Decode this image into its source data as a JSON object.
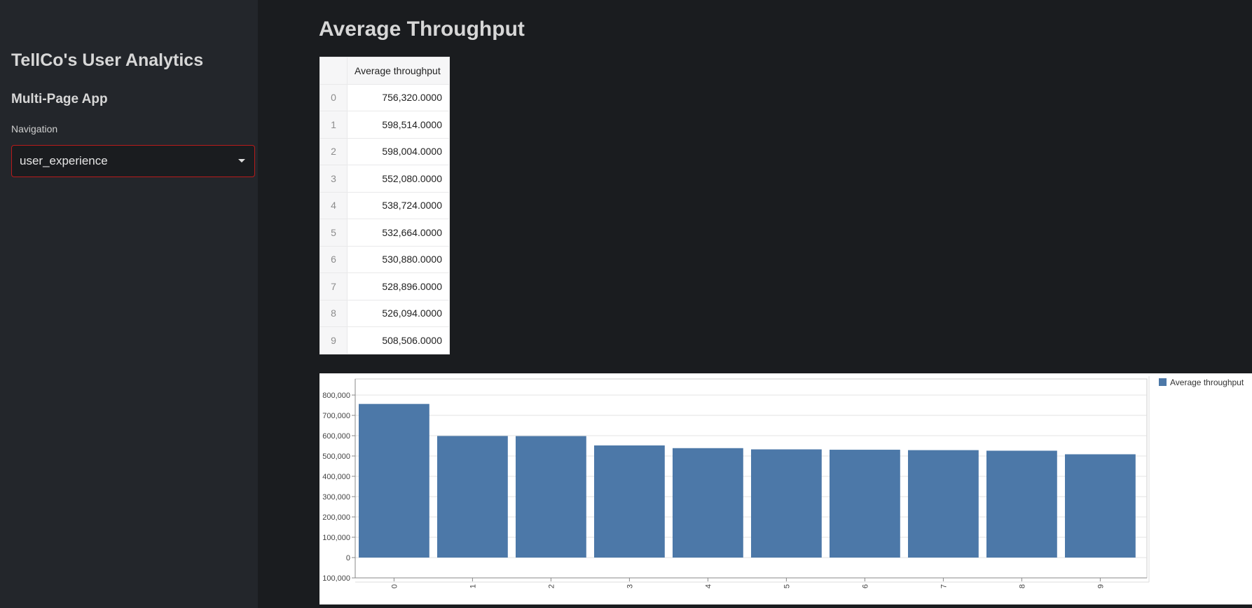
{
  "sidebar": {
    "app_title": "TellCo's User Analytics",
    "subtitle": "Multi-Page App",
    "nav_label": "Navigation",
    "selected_page": "user_experience"
  },
  "main": {
    "page_title": "Average Throughput",
    "table": {
      "columns": [
        "",
        "Average throughput"
      ],
      "rows": [
        {
          "index": "0",
          "value": "756,320.0000"
        },
        {
          "index": "1",
          "value": "598,514.0000"
        },
        {
          "index": "2",
          "value": "598,004.0000"
        },
        {
          "index": "3",
          "value": "552,080.0000"
        },
        {
          "index": "4",
          "value": "538,724.0000"
        },
        {
          "index": "5",
          "value": "532,664.0000"
        },
        {
          "index": "6",
          "value": "530,880.0000"
        },
        {
          "index": "7",
          "value": "528,896.0000"
        },
        {
          "index": "8",
          "value": "526,094.0000"
        },
        {
          "index": "9",
          "value": "508,506.0000"
        }
      ]
    }
  },
  "colors": {
    "accent": "#b81b1b",
    "bar": "#4c78a8"
  },
  "chart_data": {
    "type": "bar",
    "categories": [
      "0",
      "1",
      "2",
      "3",
      "4",
      "5",
      "6",
      "7",
      "8",
      "9"
    ],
    "series": [
      {
        "name": "Average throughput",
        "values": [
          756320,
          598514,
          598004,
          552080,
          538724,
          532664,
          530880,
          528896,
          526094,
          508506
        ]
      }
    ],
    "ylim": [
      -100000,
      800000
    ],
    "yticks": [
      -100000,
      0,
      100000,
      200000,
      300000,
      400000,
      500000,
      600000,
      700000,
      800000
    ],
    "ytick_labels": [
      "100,000",
      "0",
      "100,000",
      "200,000",
      "300,000",
      "400,000",
      "500,000",
      "600,000",
      "700,000",
      "800,000"
    ],
    "grid": true,
    "legend_position": "top-right"
  }
}
